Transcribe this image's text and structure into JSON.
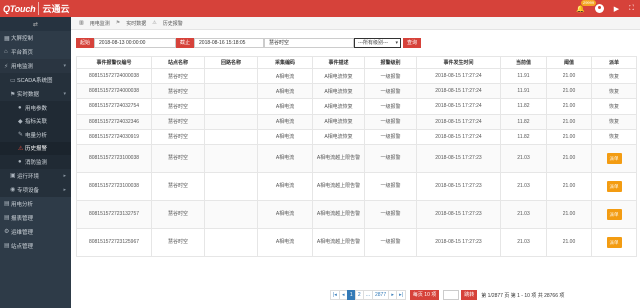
{
  "app": {
    "logo_main": "QTouch",
    "logo_cn": "云通云",
    "notification_count": "29999"
  },
  "sidebar": {
    "toggle": "⇄",
    "items": [
      {
        "label": "大屏控制",
        "icon": "▦"
      },
      {
        "label": "平台首页",
        "icon": "⌂"
      },
      {
        "label": "用电监测",
        "icon": "⚡"
      },
      {
        "label": "SCADA系统图",
        "icon": "▭"
      },
      {
        "label": "实时数据",
        "icon": "⚑"
      },
      {
        "label": "用电参数",
        "icon": "●"
      },
      {
        "label": "指标关联",
        "icon": "◆"
      },
      {
        "label": "电量分析",
        "icon": "✎"
      },
      {
        "label": "历史报警",
        "icon": "⚠"
      },
      {
        "label": "消防监测",
        "icon": "●"
      },
      {
        "label": "运行环境",
        "icon": "▣"
      },
      {
        "label": "专项设备",
        "icon": "◉"
      },
      {
        "label": "用电分析",
        "icon": "▤"
      },
      {
        "label": "报表管理",
        "icon": "▤"
      },
      {
        "label": "运维管理",
        "icon": "⚙"
      },
      {
        "label": "站点管理",
        "icon": "▤"
      }
    ]
  },
  "breadcrumb": [
    "用电监测",
    "实时数据",
    "历史报警"
  ],
  "filter": {
    "start_label": "起始",
    "start_value": "2018-08-13 00:00:00",
    "end_label": "截止",
    "end_value": "2018-08-16 15:18:05",
    "site_value": "慧谷时空",
    "level_value": "---所有级别---",
    "search_label": "查询"
  },
  "table": {
    "headers": [
      "事件报警仪编号",
      "站点名称",
      "回路名称",
      "采集编码",
      "事件描述",
      "报警级别",
      "事件发生时间",
      "当前值",
      "阈值",
      "派单"
    ],
    "rows": [
      [
        "808151572724000038",
        "慧谷时空",
        "",
        "A相电流",
        "A相电流恢复",
        "一级报警",
        "2018-08-15 17:27:24",
        "11.91",
        "21.00",
        "恢复"
      ],
      [
        "808151572724000038",
        "慧谷时空",
        "",
        "A相电流",
        "A相电流恢复",
        "一级报警",
        "2018-08-15 17:27:24",
        "11.91",
        "21.00",
        "恢复"
      ],
      [
        "808151572724032754",
        "慧谷时空",
        "",
        "A相电流",
        "A相电流恢复",
        "一级报警",
        "2018-08-15 17:27:24",
        "11.82",
        "21.00",
        "恢复"
      ],
      [
        "808151572724032346",
        "慧谷时空",
        "",
        "A相电流",
        "A相电流恢复",
        "一级报警",
        "2018-08-15 17:27:24",
        "11.82",
        "21.00",
        "恢复"
      ],
      [
        "808151572724030919",
        "慧谷时空",
        "",
        "A相电流",
        "A相电流恢复",
        "一级报警",
        "2018-08-15 17:27:24",
        "11.82",
        "21.00",
        "恢复"
      ],
      [
        "808151572723100038",
        "慧谷时空",
        "",
        "A相电流",
        "A相电流越上限告警",
        "一级报警",
        "2018-08-15 17:27:23",
        "21.03",
        "21.00",
        "派单"
      ],
      [
        "808151572723100038",
        "慧谷时空",
        "",
        "A相电流",
        "A相电流越上限告警",
        "一级报警",
        "2018-08-15 17:27:23",
        "21.03",
        "21.00",
        "派单"
      ],
      [
        "808151572723132757",
        "慧谷时空",
        "",
        "A相电流",
        "A相电流越上限告警",
        "一级报警",
        "2018-08-15 17:27:23",
        "21.03",
        "21.00",
        "派单"
      ],
      [
        "808151572723125967",
        "慧谷时空",
        "",
        "A相电流",
        "A相电流越上限告警",
        "一级报警",
        "2018-08-15 17:27:23",
        "21.03",
        "21.00",
        "派单"
      ]
    ]
  },
  "pager": {
    "first": "|◂",
    "prev": "◂",
    "pages": [
      "1",
      "2",
      "...",
      "2877"
    ],
    "next": "▸",
    "last": "▸|",
    "page_size": "每页 10 项",
    "go": "跳转",
    "summary": "第 1/2877 页 第 1 - 10 项 共 28766 项"
  }
}
